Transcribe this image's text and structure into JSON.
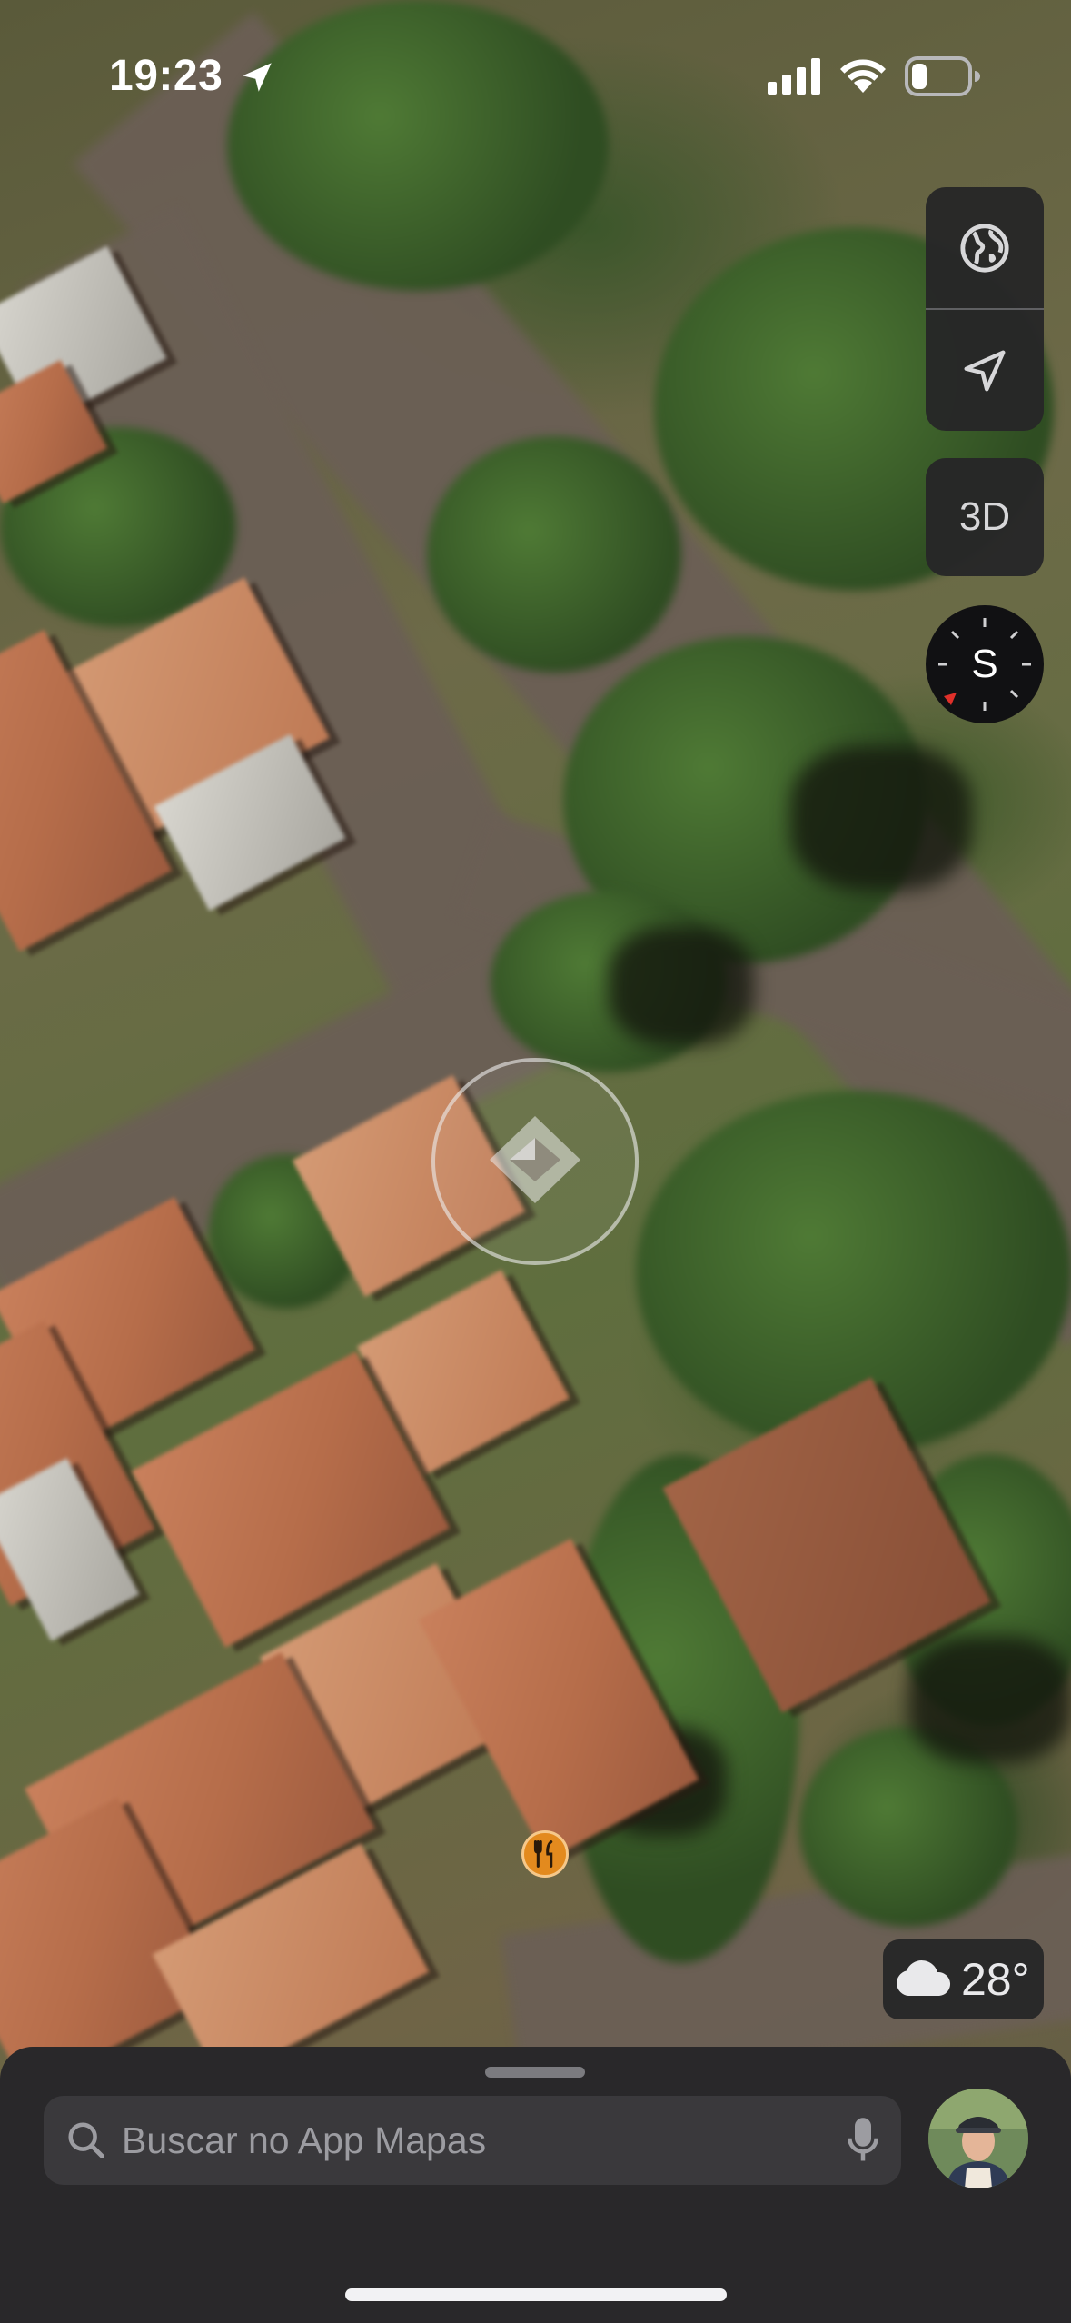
{
  "status_bar": {
    "time": "19:23",
    "location_icon": "location-arrow-icon",
    "signal_icon": "cellular-signal-icon",
    "wifi_icon": "wifi-icon",
    "battery_icon": "battery-low-icon"
  },
  "map": {
    "view": "satellite",
    "center_marker_icon": "map-center-logo-icon",
    "poi": {
      "category_icon": "fork-knife-icon",
      "color": "#e38a1e"
    }
  },
  "controls": {
    "map_mode_icon": "globe-icon",
    "tracking_icon": "location-arrow-icon",
    "three_d_label": "3D",
    "compass_heading": "S",
    "compass_needle_color": "#e0302a"
  },
  "weather": {
    "icon": "cloud-icon",
    "temperature": "28°"
  },
  "search": {
    "placeholder": "Buscar no App Mapas",
    "icon": "search-icon",
    "mic_icon": "microphone-icon"
  },
  "account": {
    "icon": "avatar"
  },
  "colors": {
    "sheet_bg": "#29282a",
    "control_bg": "#262628",
    "accent_red": "#e0302a"
  }
}
